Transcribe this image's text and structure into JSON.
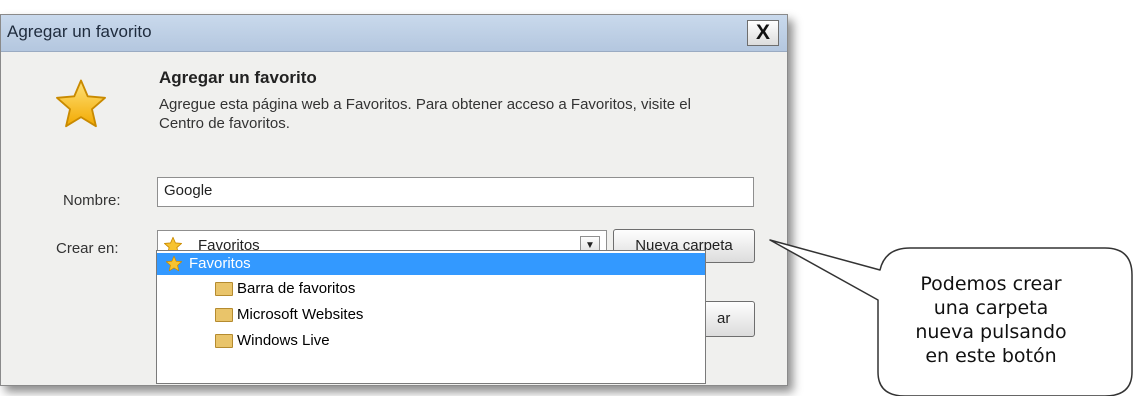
{
  "dialog": {
    "title": "Agregar un favorito",
    "close_label": "X",
    "heading": "Agregar un favorito",
    "description": "Agregue esta página web a Favoritos. Para obtener acceso a Favoritos, visite el Centro de favoritos.",
    "name_label": "Nombre:",
    "name_value": "Google",
    "create_in_label": "Crear en:",
    "create_in_value": "Favoritos",
    "new_folder_label": "Nueva carpeta",
    "partial_button_label": "ar"
  },
  "dropdown": {
    "items": [
      {
        "label": "Favoritos",
        "icon": "star-icon",
        "selected": true
      },
      {
        "label": "Barra de favoritos",
        "icon": "folder-icon",
        "selected": false
      },
      {
        "label": "Microsoft Websites",
        "icon": "folder-icon",
        "selected": false
      },
      {
        "label": "Windows Live",
        "icon": "folder-icon",
        "selected": false
      }
    ]
  },
  "callout": {
    "lines": [
      "Podemos crear",
      "una carpeta",
      "nueva pulsando",
      "en este botón"
    ]
  },
  "colors": {
    "selection": "#3399ff",
    "star": "#f4b400",
    "folder": "#e9c46a"
  }
}
